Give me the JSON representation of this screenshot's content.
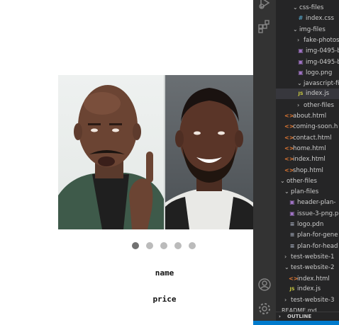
{
  "preview": {
    "slides": [
      {
        "alt": "Steve Harvey"
      },
      {
        "alt": "Michael B. Jordan"
      }
    ],
    "dots": [
      {
        "active": true
      },
      {
        "active": false
      },
      {
        "active": false
      },
      {
        "active": false
      },
      {
        "active": false
      }
    ],
    "name_label": "name",
    "price_label": "price"
  },
  "explorer": {
    "rows": [
      {
        "label": "css-files",
        "kind": "folder",
        "open": true
      },
      {
        "label": "index.css",
        "kind": "css",
        "icon": "#"
      },
      {
        "label": "img-files",
        "kind": "folder",
        "open": true
      },
      {
        "label": "fake-photos",
        "kind": "folder",
        "open": false
      },
      {
        "label": "img-0495-ba",
        "kind": "img",
        "icon": "▣"
      },
      {
        "label": "img-0495-ba",
        "kind": "img",
        "icon": "▣"
      },
      {
        "label": "logo.png",
        "kind": "img",
        "icon": "▣"
      },
      {
        "label": "javascript-files",
        "kind": "folder",
        "open": true
      },
      {
        "label": "index.js",
        "kind": "js",
        "icon": "JS",
        "selected": true
      },
      {
        "label": "other-files",
        "kind": "folder",
        "open": false
      },
      {
        "label": "about.html",
        "kind": "html",
        "icon": "<>"
      },
      {
        "label": "coming-soon.h",
        "kind": "html",
        "icon": "<>"
      },
      {
        "label": "contact.html",
        "kind": "html",
        "icon": "<>"
      },
      {
        "label": "home.html",
        "kind": "html",
        "icon": "<>"
      },
      {
        "label": "index.html",
        "kind": "html",
        "icon": "<>"
      },
      {
        "label": "shop.html",
        "kind": "html",
        "icon": "<>"
      },
      {
        "label": "other-files",
        "kind": "folder",
        "open": true
      },
      {
        "label": "plan-files",
        "kind": "folder",
        "open": true
      },
      {
        "label": "header-plan-",
        "kind": "img",
        "icon": "▣"
      },
      {
        "label": "issue-3-png.p",
        "kind": "img",
        "icon": "▣"
      },
      {
        "label": "logo.pdn",
        "kind": "file",
        "icon": "≡"
      },
      {
        "label": "plan-for-gene",
        "kind": "file",
        "icon": "≡"
      },
      {
        "label": "plan-for-head",
        "kind": "file",
        "icon": "≡"
      },
      {
        "label": "test-website-1",
        "kind": "folder",
        "open": false
      },
      {
        "label": "test-website-2",
        "kind": "folder",
        "open": true
      },
      {
        "label": "index.html",
        "kind": "html",
        "icon": "<>"
      },
      {
        "label": "index.js",
        "kind": "js",
        "icon": "JS"
      },
      {
        "label": "test-website-3",
        "kind": "folder",
        "open": false
      }
    ],
    "peek_label": "README.md",
    "outline_label": "OUTLINE"
  },
  "colors": {
    "sidebar_bg": "#252526",
    "activity_bg": "#333333",
    "selected_row": "#37373d",
    "status_bar": "#007acc",
    "dot_active": "#717171",
    "dot_inactive": "#bbbbbb"
  }
}
